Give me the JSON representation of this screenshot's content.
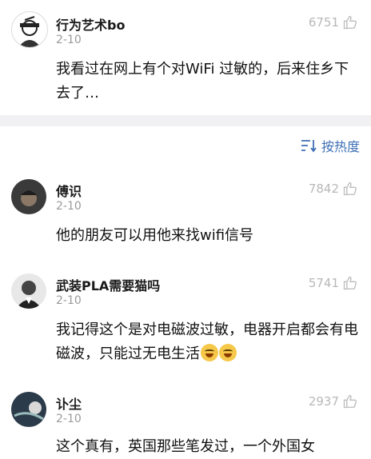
{
  "top_comment": {
    "name": "行为艺术bo",
    "date": "2-10",
    "likes": "6751",
    "text": "我看过在网上有个对WiFi 过敏的，后来住乡下去了…"
  },
  "sort": {
    "label": "按热度"
  },
  "comments": [
    {
      "name": "傅识",
      "date": "2-10",
      "likes": "7842",
      "text": "他的朋友可以用他来找wifi信号"
    },
    {
      "name": "武装PLA需要猫吗",
      "date": "2-10",
      "likes": "5741",
      "text": "我记得这个是对电磁波过敏，电器开启都会有电磁波，只能过无电生活"
    },
    {
      "name": "讣尘",
      "date": "2-10",
      "likes": "2937",
      "text": "这个真有，英国那些笔发过，一个外国女"
    }
  ]
}
